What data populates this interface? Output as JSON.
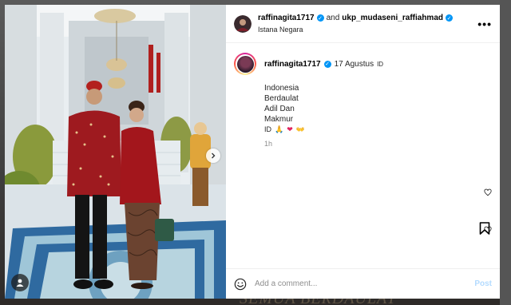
{
  "header": {
    "username": "raffinagita1717",
    "and_text": "and",
    "collaborator": "ukp_mudaseni_raffiahmad",
    "location": "Istana Negara",
    "more_label": "•••"
  },
  "caption": {
    "username": "raffinagita1717",
    "date": "17 Agustus",
    "flag": "ID",
    "lines": [
      "Indonesia",
      "Berdaulat",
      "Adil Dan",
      "Makmur"
    ],
    "emoji_line": [
      "ID",
      "🙏",
      "❤",
      "👐"
    ],
    "time_ago": "1h"
  },
  "comment": {
    "placeholder": "Add a comment...",
    "post_label": "Post"
  },
  "background_text": "SEMUA BERDAULAT",
  "colors": {
    "verified": "#0095f6",
    "post_disabled": "#b3dbff",
    "muted": "#8e8e8e"
  }
}
